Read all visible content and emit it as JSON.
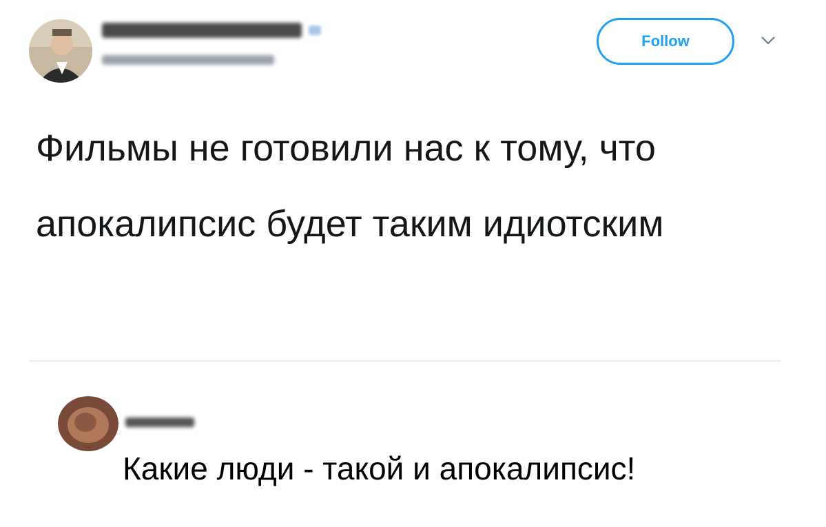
{
  "tweet": {
    "follow_label": "Follow",
    "text": "Фильмы не готовили нас к тому, что апокалипсис будет таким идиотским",
    "chevron_icon": "chevron-down-icon",
    "verified_icon": "verified-icon"
  },
  "reply": {
    "text": "Какие люди - такой и апокалипсис!"
  },
  "colors": {
    "accent": "#1da1f2",
    "divider": "#e6ecf0",
    "text": "#14171a"
  }
}
